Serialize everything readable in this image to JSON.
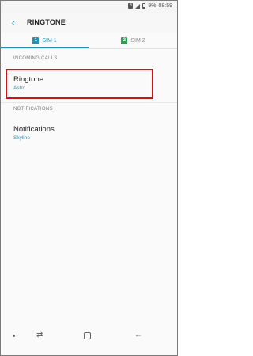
{
  "status_bar": {
    "sim_badge": "B",
    "battery_text": "9%",
    "time": "08:59"
  },
  "header": {
    "title": "RINGTONE",
    "back_icon": "back-arrow-icon"
  },
  "tabs": [
    {
      "badge": "1",
      "label": "SIM 1",
      "selected": true
    },
    {
      "badge": "2",
      "label": "SIM 2",
      "selected": false
    }
  ],
  "sections": [
    {
      "header": "INCOMING CALLS",
      "items": [
        {
          "label": "Ringtone",
          "value": "Astro"
        }
      ]
    },
    {
      "header": "NOTIFICATIONS",
      "items": [
        {
          "label": "Notifications",
          "value": "Skyline"
        }
      ]
    }
  ],
  "navbar": {
    "icons": [
      "dot-icon",
      "recents-icon",
      "home-icon",
      "back-icon"
    ]
  },
  "colors": {
    "accent": "#2a8fb3",
    "sim2": "#2e9d4f",
    "highlight": "#d0121b"
  }
}
